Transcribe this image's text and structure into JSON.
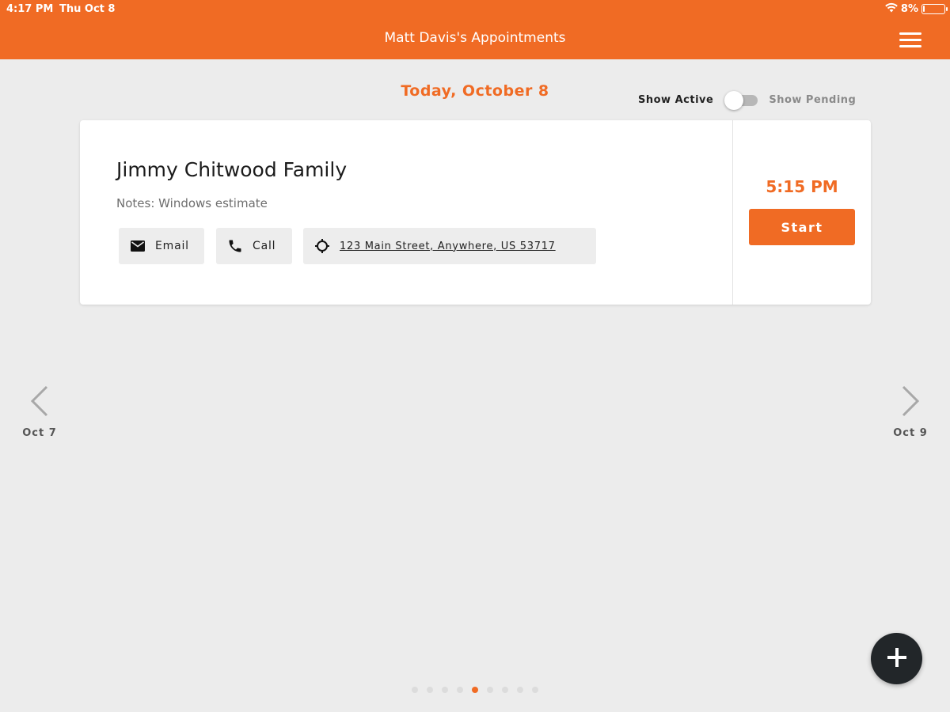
{
  "status_bar": {
    "time": "4:17 PM",
    "date": "Thu Oct 8",
    "battery": "8%",
    "battery_level": 0.08
  },
  "app_bar": {
    "title": "Matt Davis's Appointments",
    "menu_icon": "hamburger-menu-icon"
  },
  "header": {
    "date_title": "Today, October 8",
    "toggle_left_label": "Show Active",
    "toggle_right_label": "Show Pending",
    "toggle_state": "Show Active"
  },
  "appointment": {
    "name": "Jimmy Chitwood Family",
    "notes": "Notes: Windows estimate",
    "actions": {
      "email_label": "Email",
      "call_label": "Call",
      "address": "123 Main Street, Anywhere, US 53717"
    },
    "time": "5:15 PM",
    "start_label": "Start"
  },
  "navigation": {
    "prev_label": "Oct 7",
    "next_label": "Oct 9"
  },
  "pager": {
    "count": 9,
    "active_index": 4
  },
  "colors": {
    "accent": "#f06b24",
    "fab": "#222629",
    "background": "#ececec"
  }
}
